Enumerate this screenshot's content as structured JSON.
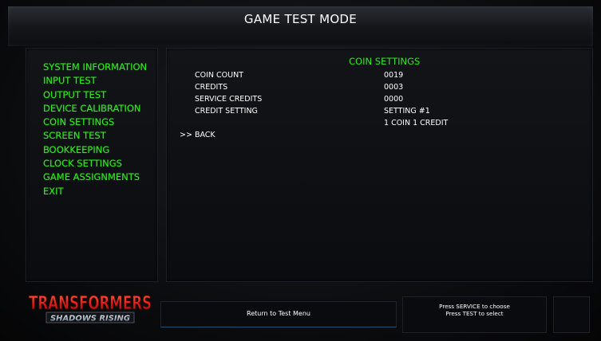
{
  "header": {
    "title": "GAME TEST MODE"
  },
  "menu": {
    "items": [
      "SYSTEM INFORMATION",
      "INPUT TEST",
      "OUTPUT TEST",
      "DEVICE CALIBRATION",
      "COIN SETTINGS",
      "SCREEN TEST",
      "BOOKKEEPING",
      "CLOCK SETTINGS",
      "GAME ASSIGNMENTS",
      "EXIT"
    ]
  },
  "content": {
    "section_title": "COIN SETTINGS",
    "rows": [
      {
        "label": "COIN COUNT",
        "value": "0019"
      },
      {
        "label": "CREDITS",
        "value": "0003"
      },
      {
        "label": "SERVICE CREDITS",
        "value": "0000"
      },
      {
        "label": "CREDIT SETTING",
        "value": "SETTING #1"
      }
    ],
    "credit_setting_detail": "1 COIN 1 CREDIT",
    "back_label": ">> BACK"
  },
  "logo": {
    "line1": "TRANSFORMERS",
    "line2": "SHADOWS RISING"
  },
  "footer": {
    "return_label": "Return to Test Menu",
    "hint_line1": "Press SERVICE to choose",
    "hint_line2": "Press TEST to select"
  },
  "colors": {
    "menu_green": "#2ee81e",
    "logo_red": "#e0201a"
  }
}
